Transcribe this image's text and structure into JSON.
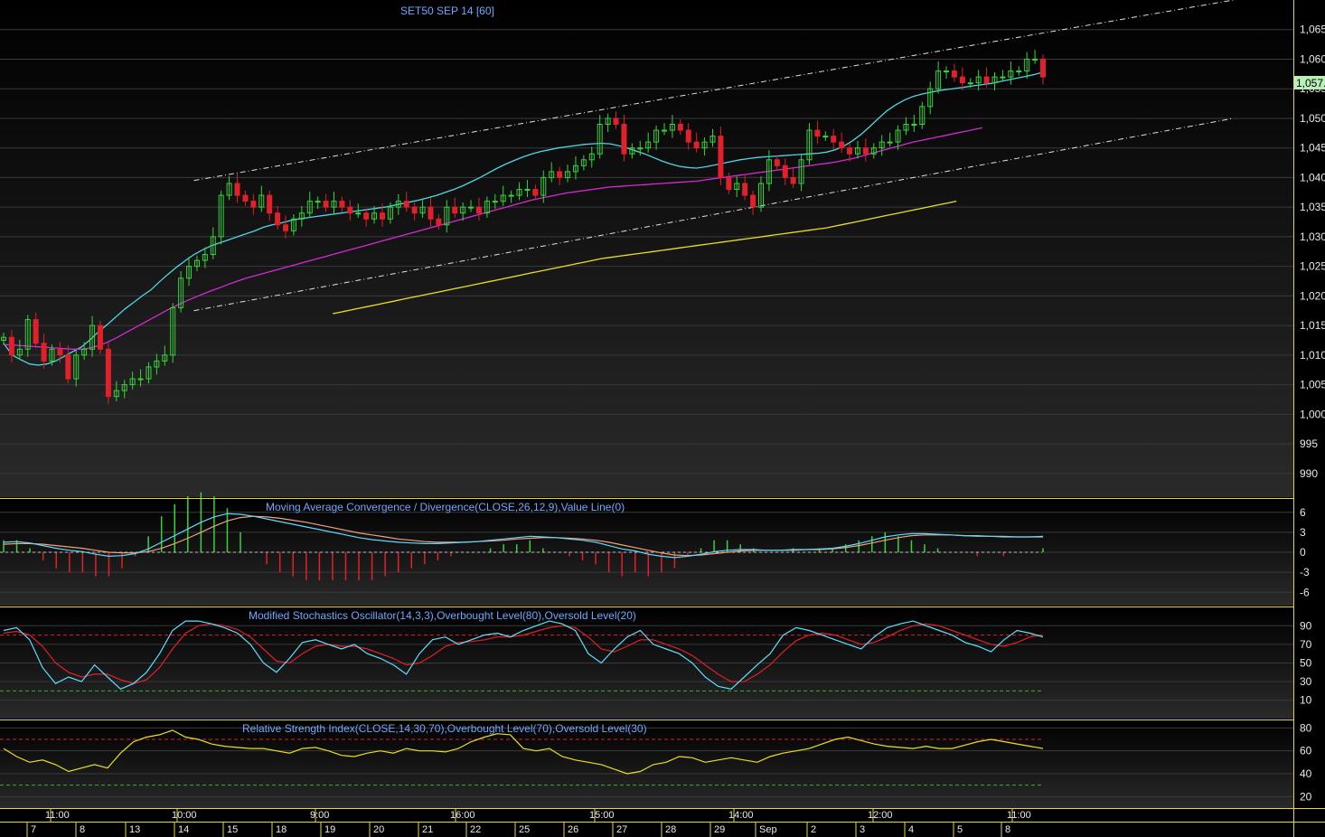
{
  "colors": {
    "background": "#000000",
    "panel_border": "#e6d63a",
    "grid": "#3a3a3a",
    "up_candle": "#35d43a",
    "down_candle": "#e0202a",
    "ma_fast": "#4fd6e6",
    "ma_mid": "#d42ad4",
    "ma_slow": "#e8e020",
    "channel": "#e0e0e0",
    "macd_line": "#5ed8ff",
    "signal_line": "#f0a27a",
    "hist_up": "#35d43a",
    "hist_down": "#e0202a",
    "stoch_k": "#5ee0ff",
    "stoch_d": "#e0202a",
    "ob_level": "#e0202a",
    "os_level": "#30b030",
    "rsi_line": "#e8e020",
    "title": "#6fa8ff",
    "last_price_bg": "#b8f0b8"
  },
  "chart_data": [
    {
      "type": "candlestick",
      "title": "SET50 SEP 14   [60]",
      "ylim": [
        986,
        1070
      ],
      "yticks": [
        "1,065",
        "1,060",
        "1,055",
        "1,050",
        "1,045",
        "1,040",
        "1,035",
        "1,030",
        "1,025",
        "1,020",
        "1,015",
        "1,010",
        "1,005",
        "1,000",
        "995",
        "990"
      ],
      "last_price_label": "1,057.",
      "last_price": 1057.3,
      "series": [
        {
          "role": "ma_fast",
          "values": [
            1012,
            1010,
            1009.2,
            1008.5,
            1008.3,
            1008.5,
            1009,
            1009.8,
            1010.6,
            1011.4,
            1012.6,
            1014,
            1015.2,
            1016.5,
            1017.8,
            1018.9,
            1020,
            1021,
            1022.4,
            1023.7,
            1024.9,
            1026,
            1027,
            1027.8,
            1028.5,
            1029,
            1029.5,
            1030,
            1030.5,
            1031,
            1031.6,
            1032,
            1032.3,
            1032.7,
            1033,
            1033.2,
            1033.4,
            1033.6,
            1033.8,
            1034,
            1034.2,
            1034.4,
            1034.6,
            1034.8,
            1035,
            1035.3,
            1035.6,
            1035.9,
            1036.2,
            1036.6,
            1037,
            1037.5,
            1038,
            1038.6,
            1039.3,
            1040,
            1040.8,
            1041.6,
            1042.3,
            1042.9,
            1043.5,
            1044,
            1044.4,
            1044.7,
            1045,
            1045.2,
            1045.4,
            1045.6,
            1045.7,
            1045.8,
            1045.7,
            1045.4,
            1045,
            1044.5,
            1044,
            1043.4,
            1042.8,
            1042.3,
            1041.9,
            1041.7,
            1041.6,
            1041.8,
            1042.1,
            1042.4,
            1042.7,
            1043,
            1043.2,
            1043.4,
            1043.5,
            1043.6,
            1043.7,
            1043.8,
            1043.9,
            1044,
            1044.1,
            1044.3,
            1044.7,
            1045.3,
            1046.2,
            1047.3,
            1048.6,
            1050,
            1051.3,
            1052.3,
            1053.1,
            1053.7,
            1054.1,
            1054.4,
            1054.7,
            1054.9,
            1055.1,
            1055.3,
            1055.5,
            1055.7,
            1055.9,
            1056.2,
            1056.5,
            1056.8,
            1057.1,
            1057.4,
            1057.8
          ]
        },
        {
          "role": "ma_mid",
          "values": [
            1011.8,
            1011.7,
            1011.6,
            1011.5,
            1011.4,
            1011.3,
            1011.2,
            1011.1,
            1011,
            1011,
            1011.2,
            1011.6,
            1012.2,
            1012.9,
            1013.7,
            1014.5,
            1015.3,
            1016.1,
            1016.9,
            1017.7,
            1018.4,
            1019.1,
            1019.7,
            1020.3,
            1020.9,
            1021.4,
            1022,
            1022.5,
            1023,
            1023.4,
            1023.8,
            1024.2,
            1024.6,
            1025,
            1025.4,
            1025.8,
            1026.2,
            1026.6,
            1027,
            1027.4,
            1027.8,
            1028.2,
            1028.6,
            1029,
            1029.4,
            1029.8,
            1030.2,
            1030.6,
            1031,
            1031.4,
            1031.8,
            1032.2,
            1032.6,
            1033,
            1033.4,
            1033.8,
            1034.2,
            1034.6,
            1035,
            1035.4,
            1035.8,
            1036.2,
            1036.5,
            1036.8,
            1037.1,
            1037.4,
            1037.6,
            1037.8,
            1038,
            1038.2,
            1038.4,
            1038.5,
            1038.6,
            1038.7,
            1038.8,
            1038.9,
            1039,
            1039.1,
            1039.2,
            1039.3,
            1039.4,
            1039.6,
            1039.8,
            1040,
            1040.2,
            1040.4,
            1040.6,
            1040.8,
            1041,
            1041.2,
            1041.4,
            1041.6,
            1041.8,
            1042,
            1042.2,
            1042.4,
            1042.6,
            1042.9,
            1043.2,
            1043.6,
            1044,
            1044.4,
            1044.8,
            1045.2,
            1045.6,
            1046,
            1046.3,
            1046.6,
            1046.9,
            1047.2,
            1047.5,
            1047.8,
            1048.1,
            1048.4
          ]
        },
        {
          "role": "ma_slow",
          "start_index": 38,
          "values": [
            1017,
            1017.3,
            1017.6,
            1017.9,
            1018.2,
            1018.5,
            1018.8,
            1019.1,
            1019.4,
            1019.7,
            1020,
            1020.3,
            1020.6,
            1020.9,
            1021.2,
            1021.5,
            1021.8,
            1022.1,
            1022.4,
            1022.7,
            1023,
            1023.3,
            1023.6,
            1023.9,
            1024.2,
            1024.5,
            1024.8,
            1025.1,
            1025.4,
            1025.7,
            1026,
            1026.3,
            1026.5,
            1026.7,
            1026.9,
            1027.1,
            1027.3,
            1027.5,
            1027.7,
            1027.9,
            1028.1,
            1028.3,
            1028.5,
            1028.7,
            1028.9,
            1029.1,
            1029.3,
            1029.5,
            1029.7,
            1029.9,
            1030.1,
            1030.3,
            1030.5,
            1030.7,
            1030.9,
            1031.1,
            1031.3,
            1031.5,
            1031.8,
            1032.1,
            1032.4,
            1032.7,
            1033,
            1033.3,
            1033.6,
            1033.9,
            1034.2,
            1034.5,
            1034.8,
            1035.1,
            1035.4,
            1035.7,
            1036
          ]
        }
      ],
      "ohlc_close": [
        1013,
        1010,
        1011,
        1016,
        1012,
        1009,
        1011,
        1010,
        1006,
        1010,
        1011,
        1015,
        1011,
        1003,
        1004,
        1005,
        1006,
        1006,
        1008,
        1009,
        1010,
        1018,
        1023,
        1025,
        1026,
        1027,
        1030,
        1037,
        1039,
        1037,
        1036,
        1035,
        1037,
        1034,
        1032,
        1031,
        1033,
        1034,
        1036,
        1036,
        1035,
        1036,
        1035,
        1034,
        1034,
        1033,
        1034,
        1033,
        1035,
        1036,
        1035,
        1034,
        1035,
        1033,
        1032,
        1035,
        1034,
        1035,
        1035,
        1034,
        1036,
        1036,
        1037,
        1037,
        1038,
        1038,
        1037,
        1040,
        1041,
        1040,
        1041,
        1042,
        1043,
        1044,
        1049,
        1050,
        1049,
        1044,
        1045,
        1045,
        1046,
        1048,
        1048,
        1049,
        1048,
        1046,
        1045,
        1046,
        1047,
        1040,
        1038,
        1039,
        1037,
        1035,
        1039,
        1043,
        1042,
        1040,
        1039,
        1043,
        1048,
        1047,
        1047,
        1046,
        1045,
        1044,
        1045,
        1044,
        1045,
        1046,
        1046,
        1048,
        1049,
        1049,
        1052,
        1055,
        1058,
        1058,
        1057,
        1056,
        1056,
        1057,
        1056,
        1057,
        1057,
        1058,
        1058,
        1060,
        1060,
        1057
      ],
      "channel_lines": [
        {
          "from": [
            28,
            1039.5
          ],
          "to": [
            181,
            1070
          ]
        },
        {
          "from": [
            28,
            1017.5
          ],
          "to": [
            181,
            1050
          ]
        }
      ]
    },
    {
      "type": "line",
      "title": "Moving Average Convergence / Divergence(CLOSE,26,12,9),Value Line(0)",
      "ylim": [
        -8,
        8
      ],
      "yticks": [
        "6",
        "3",
        "0",
        "-3",
        "-6"
      ],
      "series": [
        {
          "role": "macd",
          "values": [
            1.5,
            1.6,
            1.4,
            1.0,
            0.6,
            0.3,
            0.1,
            -0.3,
            -0.6,
            -0.5,
            -0.2,
            0.5,
            1.5,
            2.5,
            3.5,
            4.5,
            5.3,
            5.8,
            5.7,
            5.4,
            5.0,
            4.6,
            4.2,
            3.8,
            3.4,
            3.0,
            2.6,
            2.2,
            1.9,
            1.7,
            1.5,
            1.4,
            1.3,
            1.3,
            1.4,
            1.5,
            1.6,
            1.8,
            2.0,
            2.2,
            2.4,
            2.3,
            2.2,
            2.0,
            1.8,
            1.5,
            1.0,
            0.5,
            0.2,
            -0.3,
            -0.6,
            -0.8,
            -0.6,
            -0.3,
            0.1,
            0.3,
            0.4,
            0.4,
            0.3,
            0.3,
            0.4,
            0.4,
            0.5,
            0.6,
            0.9,
            1.3,
            1.8,
            2.3,
            2.6,
            2.8,
            2.8,
            2.7,
            2.6,
            2.5,
            2.4,
            2.4,
            2.3,
            2.3,
            2.3,
            2.4
          ]
        },
        {
          "role": "signal",
          "values": [
            1.2,
            1.3,
            1.3,
            1.2,
            1.0,
            0.8,
            0.6,
            0.3,
            0.0,
            -0.1,
            -0.1,
            0.1,
            0.6,
            1.3,
            2.1,
            3.0,
            3.9,
            4.7,
            5.2,
            5.4,
            5.3,
            5.1,
            4.8,
            4.5,
            4.1,
            3.7,
            3.3,
            2.9,
            2.6,
            2.3,
            2.0,
            1.8,
            1.6,
            1.5,
            1.5,
            1.5,
            1.6,
            1.7,
            1.8,
            2.0,
            2.1,
            2.2,
            2.2,
            2.1,
            2.0,
            1.8,
            1.5,
            1.1,
            0.7,
            0.3,
            -0.1,
            -0.4,
            -0.5,
            -0.4,
            -0.2,
            0.0,
            0.2,
            0.3,
            0.3,
            0.3,
            0.3,
            0.4,
            0.4,
            0.5,
            0.7,
            1.0,
            1.4,
            1.8,
            2.2,
            2.5,
            2.6,
            2.6,
            2.6,
            2.5,
            2.5,
            2.4,
            2.4,
            2.3,
            2.3,
            2.3
          ]
        }
      ]
    },
    {
      "type": "line",
      "title": "Modified Stochastics Oscillator(14,3,3),Overbought Level(80),Oversold Level(20)",
      "ylim": [
        0,
        100
      ],
      "yticks": [
        "90",
        "70",
        "50",
        "30",
        "10"
      ],
      "overbought": 80,
      "oversold": 20,
      "series": [
        {
          "role": "k",
          "values": [
            85,
            88,
            75,
            45,
            28,
            35,
            30,
            48,
            35,
            22,
            28,
            40,
            60,
            85,
            95,
            95,
            92,
            88,
            82,
            70,
            50,
            40,
            55,
            72,
            75,
            70,
            65,
            70,
            60,
            55,
            48,
            38,
            60,
            75,
            78,
            70,
            75,
            80,
            82,
            78,
            85,
            90,
            95,
            92,
            85,
            60,
            50,
            65,
            78,
            85,
            70,
            65,
            60,
            50,
            35,
            25,
            22,
            35,
            48,
            60,
            80,
            88,
            85,
            80,
            75,
            70,
            65,
            78,
            88,
            92,
            95,
            90,
            85,
            80,
            72,
            68,
            62,
            75,
            85,
            82,
            78
          ]
        },
        {
          "role": "d",
          "values": [
            82,
            84,
            80,
            68,
            50,
            40,
            35,
            38,
            38,
            32,
            28,
            32,
            45,
            65,
            82,
            90,
            92,
            90,
            86,
            78,
            65,
            52,
            50,
            60,
            68,
            70,
            68,
            68,
            65,
            60,
            55,
            48,
            50,
            58,
            68,
            72,
            73,
            75,
            78,
            78,
            80,
            84,
            88,
            90,
            88,
            78,
            65,
            62,
            68,
            75,
            75,
            70,
            65,
            58,
            48,
            38,
            30,
            30,
            38,
            48,
            62,
            74,
            80,
            82,
            80,
            75,
            70,
            72,
            78,
            85,
            90,
            92,
            90,
            85,
            80,
            75,
            70,
            68,
            72,
            78,
            80
          ]
        }
      ]
    },
    {
      "type": "line",
      "title": "Relative Strength Index(CLOSE,14,30,70),Overbought Level(70),Oversold Level(30)",
      "ylim": [
        10,
        85
      ],
      "yticks": [
        "80",
        "60",
        "40",
        "20"
      ],
      "overbought": 70,
      "oversold": 30,
      "series": [
        {
          "role": "rsi",
          "values": [
            62,
            55,
            50,
            52,
            48,
            42,
            45,
            48,
            45,
            58,
            68,
            72,
            74,
            78,
            72,
            70,
            66,
            64,
            63,
            62,
            62,
            60,
            58,
            62,
            63,
            60,
            56,
            55,
            58,
            60,
            58,
            62,
            60,
            60,
            59,
            62,
            68,
            72,
            75,
            74,
            62,
            60,
            62,
            55,
            52,
            50,
            48,
            44,
            40,
            42,
            48,
            50,
            55,
            54,
            50,
            52,
            54,
            52,
            50,
            55,
            58,
            60,
            62,
            66,
            70,
            72,
            69,
            66,
            64,
            63,
            62,
            64,
            62,
            62,
            65,
            68,
            70,
            68,
            66,
            64,
            62
          ]
        }
      ]
    }
  ],
  "time_axis": {
    "time_labels": [
      "11:00",
      "10:00",
      "9:00",
      "16:00",
      "15:00",
      "14:00",
      "12:00",
      "11:00"
    ],
    "date_labels": [
      "7",
      "8",
      "13",
      "14",
      "15",
      "18",
      "19",
      "20",
      "21",
      "22",
      "25",
      "26",
      "27",
      "28",
      "29",
      "Sep",
      "2",
      "3",
      "4",
      "5",
      "8"
    ]
  }
}
